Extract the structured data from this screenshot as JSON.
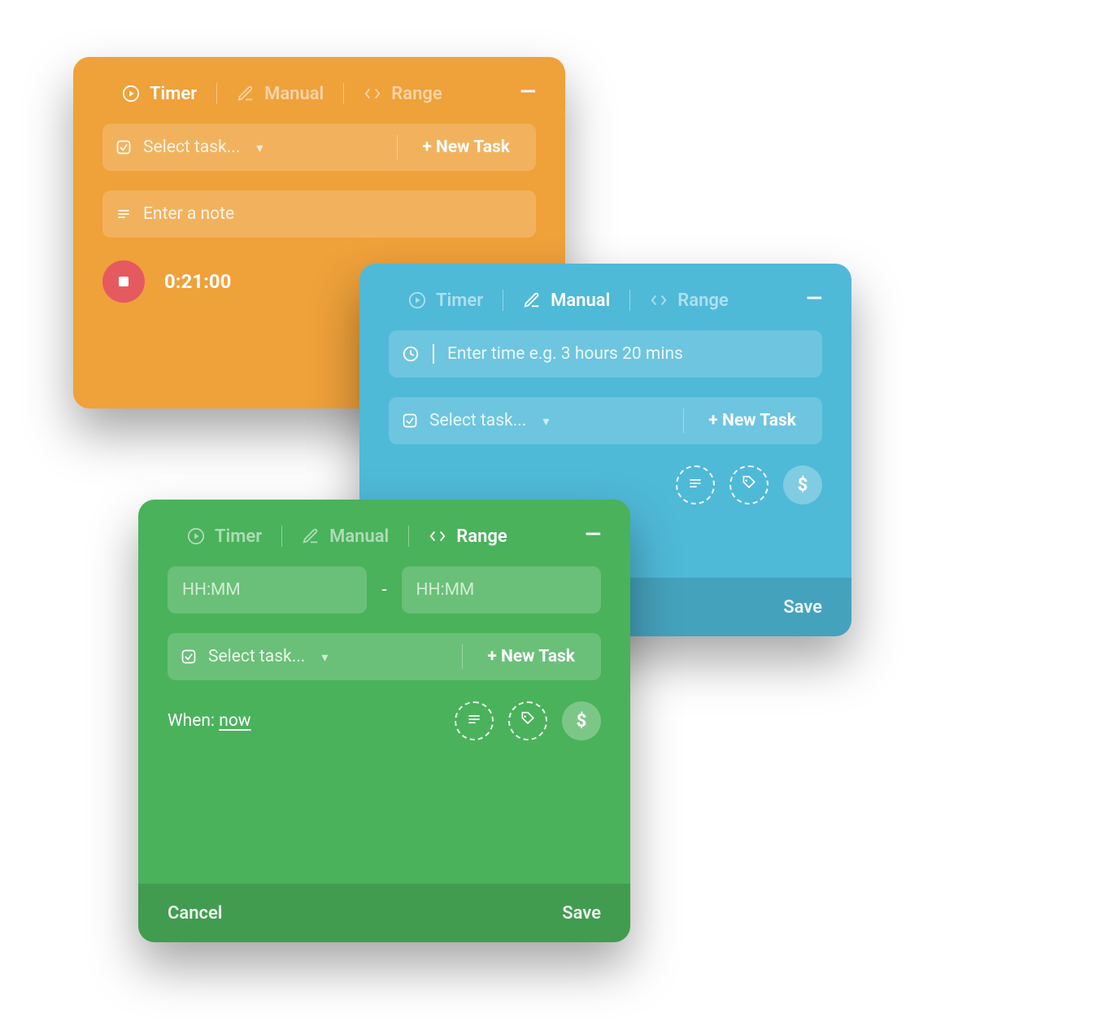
{
  "tabs": {
    "timer": "Timer",
    "manual": "Manual",
    "range": "Range"
  },
  "common": {
    "select_task": "Select task...",
    "new_task": "+ New Task",
    "note_placeholder": "Enter a note",
    "cancel": "Cancel",
    "save": "Save",
    "hhmm": "HH:MM",
    "minimize": "—"
  },
  "orange": {
    "active_tab": "Timer",
    "timer_value": "0:21:00"
  },
  "blue": {
    "active_tab": "Manual",
    "time_placeholder": "Enter time e.g. 3 hours 20 mins"
  },
  "green": {
    "active_tab": "Range",
    "when_label": "When: ",
    "when_value": "now",
    "dash": "-"
  }
}
